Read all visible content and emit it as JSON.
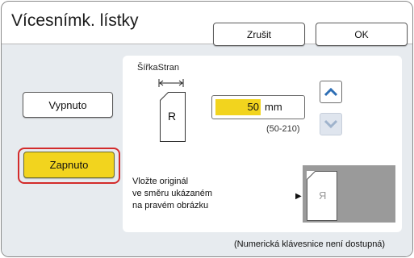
{
  "window": {
    "title": "Vícesnímk. lístky"
  },
  "actions": {
    "cancel_label": "Zrušit",
    "ok_label": "OK"
  },
  "mode": {
    "off_label": "Vypnuto",
    "on_label": "Zapnuto",
    "selected": "Zapnuto"
  },
  "width": {
    "label": "ŠířkaStran",
    "value": "50",
    "unit": "mm",
    "range": "(50-210)",
    "doc_letter": "R"
  },
  "instruction": {
    "line1": "Vložte originál",
    "line2": "ve směru ukázaném",
    "line3": "na pravém obrázku",
    "preview_letter": "Я"
  },
  "footer": {
    "note": "(Numerická klávesnice není dostupná)"
  },
  "colors": {
    "accent_yellow": "#f2d41e",
    "selection_red": "#d32b2b",
    "stepper_blue": "#2e6fb5",
    "stepper_disabled": "#9fb3cc"
  }
}
